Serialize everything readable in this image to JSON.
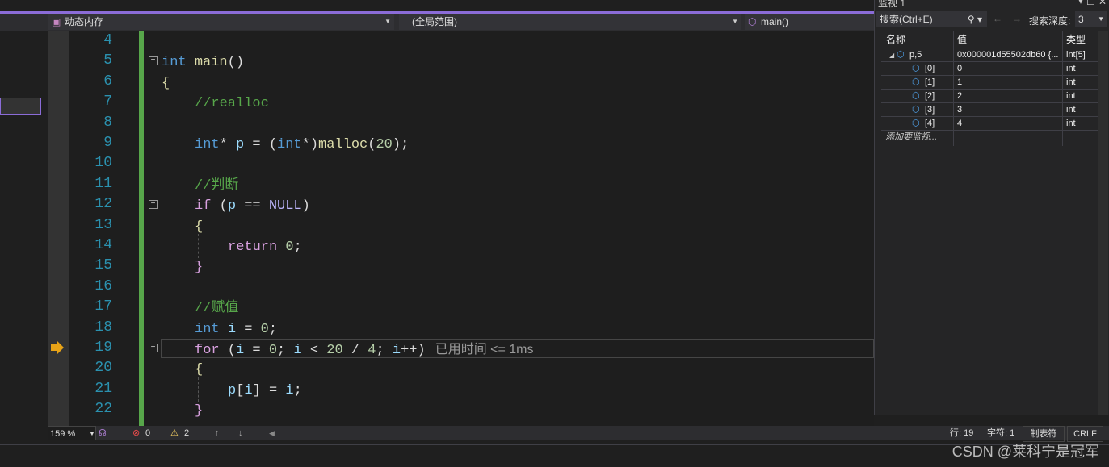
{
  "nav": {
    "file_scope": "动态内存",
    "global_scope": "(全局范围)",
    "function": "main()"
  },
  "code": {
    "line_numbers": [
      "4",
      "5",
      "6",
      "7",
      "8",
      "9",
      "10",
      "11",
      "12",
      "13",
      "14",
      "15",
      "16",
      "17",
      "18",
      "19",
      "20",
      "21",
      "22"
    ],
    "lines": [
      {
        "indent": 0,
        "tokens": []
      },
      {
        "indent": 0,
        "tokens": [
          [
            "int",
            "kw"
          ],
          [
            " ",
            ""
          ],
          [
            "main",
            "fn"
          ],
          [
            "()",
            "br"
          ]
        ]
      },
      {
        "indent": 0,
        "tokens": [
          [
            "{",
            "fn"
          ]
        ]
      },
      {
        "indent": 1,
        "tokens": [
          [
            "//realloc",
            "cm"
          ]
        ]
      },
      {
        "indent": 1,
        "tokens": []
      },
      {
        "indent": 1,
        "tokens": [
          [
            "int",
            "kw"
          ],
          [
            "* ",
            ""
          ],
          [
            "p",
            "var"
          ],
          [
            " = (",
            ""
          ],
          [
            "int",
            "kw"
          ],
          [
            "*)",
            ""
          ],
          [
            "malloc",
            "fn"
          ],
          [
            "(",
            ""
          ],
          [
            "20",
            "num"
          ],
          [
            ");",
            ""
          ]
        ]
      },
      {
        "indent": 1,
        "tokens": []
      },
      {
        "indent": 1,
        "tokens": [
          [
            "//判断",
            "cm"
          ]
        ]
      },
      {
        "indent": 1,
        "tokens": [
          [
            "if",
            "ctl"
          ],
          [
            " (",
            ""
          ],
          [
            "p",
            "var"
          ],
          [
            " == ",
            ""
          ],
          [
            "NULL",
            "mac"
          ],
          [
            ")",
            ""
          ]
        ]
      },
      {
        "indent": 1,
        "tokens": [
          [
            "{",
            "fn"
          ]
        ]
      },
      {
        "indent": 2,
        "tokens": [
          [
            "return",
            "ctl"
          ],
          [
            " ",
            ""
          ],
          [
            "0",
            "num"
          ],
          [
            ";",
            ""
          ]
        ]
      },
      {
        "indent": 1,
        "tokens": [
          [
            "}",
            "ctl"
          ]
        ]
      },
      {
        "indent": 1,
        "tokens": []
      },
      {
        "indent": 1,
        "tokens": [
          [
            "//赋值",
            "cm"
          ]
        ]
      },
      {
        "indent": 1,
        "tokens": [
          [
            "int",
            "kw"
          ],
          [
            " ",
            ""
          ],
          [
            "i",
            "var"
          ],
          [
            " = ",
            ""
          ],
          [
            "0",
            "num"
          ],
          [
            ";",
            ""
          ]
        ]
      },
      {
        "indent": 1,
        "tokens": [
          [
            "for",
            "ctl"
          ],
          [
            " (",
            ""
          ],
          [
            "i",
            "var"
          ],
          [
            " = ",
            ""
          ],
          [
            "0",
            "num"
          ],
          [
            "; ",
            ""
          ],
          [
            "i",
            "var"
          ],
          [
            " < ",
            ""
          ],
          [
            "20",
            "num"
          ],
          [
            " / ",
            ""
          ],
          [
            "4",
            "num"
          ],
          [
            "; ",
            ""
          ],
          [
            "i",
            "var"
          ],
          [
            "++)",
            ""
          ]
        ]
      },
      {
        "indent": 1,
        "tokens": [
          [
            "{",
            "fn"
          ]
        ]
      },
      {
        "indent": 2,
        "tokens": [
          [
            "p",
            "var"
          ],
          [
            "[",
            ""
          ],
          [
            "i",
            "var"
          ],
          [
            "] = ",
            ""
          ],
          [
            "i",
            "var"
          ],
          [
            ";",
            ""
          ]
        ]
      },
      {
        "indent": 1,
        "tokens": [
          [
            "}",
            "ctl"
          ]
        ]
      }
    ],
    "perf_tip": "已用时间 <= 1ms"
  },
  "status": {
    "zoom": "159 %",
    "errors": "0",
    "warnings": "2",
    "line": "行: 19",
    "char": "字符: 1",
    "tabs": "制表符",
    "eol": "CRLF"
  },
  "watch": {
    "title": "监视 1",
    "search_placeholder": "搜索(Ctrl+E)",
    "depth_label": "搜索深度:",
    "depth_value": "3",
    "headers": [
      "名称",
      "值",
      "类型"
    ],
    "rows": [
      {
        "name": "p,5",
        "value": "0x000001d55502db60 {...",
        "type": "int[5]"
      },
      {
        "name": "[0]",
        "value": "0",
        "type": "int"
      },
      {
        "name": "[1]",
        "value": "1",
        "type": "int"
      },
      {
        "name": "[2]",
        "value": "2",
        "type": "int"
      },
      {
        "name": "[3]",
        "value": "3",
        "type": "int"
      },
      {
        "name": "[4]",
        "value": "4",
        "type": "int"
      }
    ],
    "add_item": "添加要监视..."
  },
  "watermark": "CSDN @莱科宁是冠军",
  "colors": {
    "accent": "#8b6cd8",
    "change_bar": "#57a64a",
    "keyword": "#569cd6",
    "control": "#d8a0df",
    "comment": "#57a64a"
  }
}
